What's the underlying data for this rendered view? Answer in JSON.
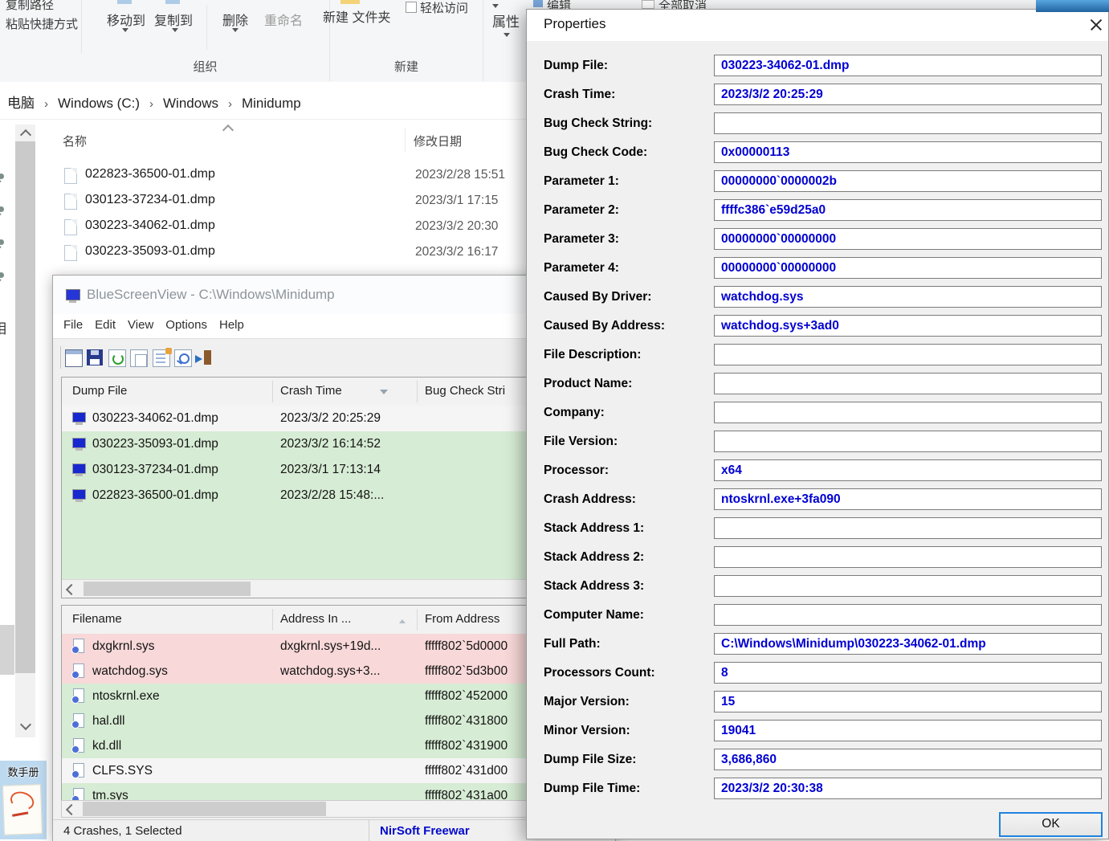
{
  "colors": {
    "value_blue": "#0000d2",
    "row_green": "#d6ecd4",
    "row_pink": "#f8d8d8",
    "link_blue": "#0008cc",
    "focus_blue": "#1f83dd"
  },
  "explorer": {
    "ribbon": {
      "copy_path": "复制路径",
      "paste_shortcut": "粘贴快捷方式",
      "move_to": "移动到",
      "copy_to": "复制到",
      "delete": "删除",
      "rename": "重命名",
      "new_folder": "新建 文件夹",
      "easy_access": "轻松访问",
      "properties": "属性",
      "edit": "编辑",
      "unselect_all": "全部取消",
      "group_organize": "组织",
      "group_new": "新建"
    },
    "breadcrumb": {
      "items": [
        {
          "sep": "",
          "label": "电脑"
        },
        {
          "sep": "›",
          "label": "Windows (C:)"
        },
        {
          "sep": "›",
          "label": "Windows"
        },
        {
          "sep": "›",
          "label": "Minidump"
        }
      ]
    },
    "list": {
      "col_name": "名称",
      "col_date": "修改日期",
      "files": [
        {
          "name": "022823-36500-01.dmp",
          "date": "2023/2/28 15:51"
        },
        {
          "name": "030123-37234-01.dmp",
          "date": "2023/3/1 17:15"
        },
        {
          "name": "030223-34062-01.dmp",
          "date": "2023/3/2 20:30"
        },
        {
          "name": "030223-35093-01.dmp",
          "date": "2023/3/2 16:17"
        }
      ]
    },
    "nav_partial_label": "相",
    "desktop_icon_label": "数手册"
  },
  "bsv": {
    "title": "BlueScreenView  -  C:\\Windows\\Minidump",
    "menus": [
      {
        "label": "File"
      },
      {
        "label": "Edit"
      },
      {
        "label": "View"
      },
      {
        "label": "Options"
      },
      {
        "label": "Help"
      }
    ],
    "toolbar_icons": [
      "app-window-icon",
      "save-icon",
      "refresh-icon",
      "copy-icon",
      "properties-icon",
      "find-icon",
      "exit-icon"
    ],
    "upper": {
      "col_file": "Dump File",
      "col_time": "Crash Time",
      "col_bug": "Bug Check Stri",
      "rows": [
        {
          "file": "030223-34062-01.dmp",
          "time": "2023/3/2 20:25:29",
          "hl": "selected"
        },
        {
          "file": "030223-35093-01.dmp",
          "time": "2023/3/2 16:14:52",
          "hl": "green"
        },
        {
          "file": "030123-37234-01.dmp",
          "time": "2023/3/1 17:13:14",
          "hl": "green"
        },
        {
          "file": "022823-36500-01.dmp",
          "time": "2023/2/28 15:48:...",
          "hl": "green"
        }
      ]
    },
    "lower": {
      "col_file": "Filename",
      "col_addr": "Address In ...",
      "col_from": "From Address",
      "rows": [
        {
          "file": "dxgkrnl.sys",
          "addr": "dxgkrnl.sys+19d...",
          "from": "fffff802`5d0000",
          "hl": "pink"
        },
        {
          "file": "watchdog.sys",
          "addr": "watchdog.sys+3...",
          "from": "fffff802`5d3b00",
          "hl": "pink"
        },
        {
          "file": "ntoskrnl.exe",
          "addr": "",
          "from": "fffff802`452000",
          "hl": "green"
        },
        {
          "file": "hal.dll",
          "addr": "",
          "from": "fffff802`431800",
          "hl": "green"
        },
        {
          "file": "kd.dll",
          "addr": "",
          "from": "fffff802`431900",
          "hl": "green"
        },
        {
          "file": "CLFS.SYS",
          "addr": "",
          "from": "fffff802`431d00",
          "hl": "selected"
        },
        {
          "file": "tm.sys",
          "addr": "",
          "from": "fffff802`431a00",
          "hl": "green"
        }
      ]
    },
    "status_left": "4 Crashes, 1 Selected",
    "status_right": "NirSoft Freewar"
  },
  "dialog": {
    "title": "Properties",
    "ok_label": "OK",
    "fields": [
      {
        "label": "Dump File:",
        "value": "030223-34062-01.dmp"
      },
      {
        "label": "Crash Time:",
        "value": "2023/3/2 20:25:29"
      },
      {
        "label": "Bug Check String:",
        "value": ""
      },
      {
        "label": "Bug Check Code:",
        "value": "0x00000113"
      },
      {
        "label": "Parameter 1:",
        "value": "00000000`0000002b"
      },
      {
        "label": "Parameter 2:",
        "value": "ffffc386`e59d25a0"
      },
      {
        "label": "Parameter 3:",
        "value": "00000000`00000000"
      },
      {
        "label": "Parameter 4:",
        "value": "00000000`00000000"
      },
      {
        "label": "Caused By Driver:",
        "value": "watchdog.sys"
      },
      {
        "label": "Caused By Address:",
        "value": "watchdog.sys+3ad0"
      },
      {
        "label": "File Description:",
        "value": ""
      },
      {
        "label": "Product Name:",
        "value": ""
      },
      {
        "label": "Company:",
        "value": ""
      },
      {
        "label": "File Version:",
        "value": ""
      },
      {
        "label": "Processor:",
        "value": "x64"
      },
      {
        "label": "Crash Address:",
        "value": "ntoskrnl.exe+3fa090"
      },
      {
        "label": "Stack Address 1:",
        "value": ""
      },
      {
        "label": "Stack Address 2:",
        "value": ""
      },
      {
        "label": "Stack Address 3:",
        "value": ""
      },
      {
        "label": "Computer Name:",
        "value": ""
      },
      {
        "label": "Full Path:",
        "value": "C:\\Windows\\Minidump\\030223-34062-01.dmp"
      },
      {
        "label": "Processors Count:",
        "value": "8"
      },
      {
        "label": "Major Version:",
        "value": "15"
      },
      {
        "label": "Minor Version:",
        "value": "19041"
      },
      {
        "label": "Dump File Size:",
        "value": "3,686,860"
      },
      {
        "label": "Dump File Time:",
        "value": "2023/3/2 20:30:38"
      }
    ]
  }
}
